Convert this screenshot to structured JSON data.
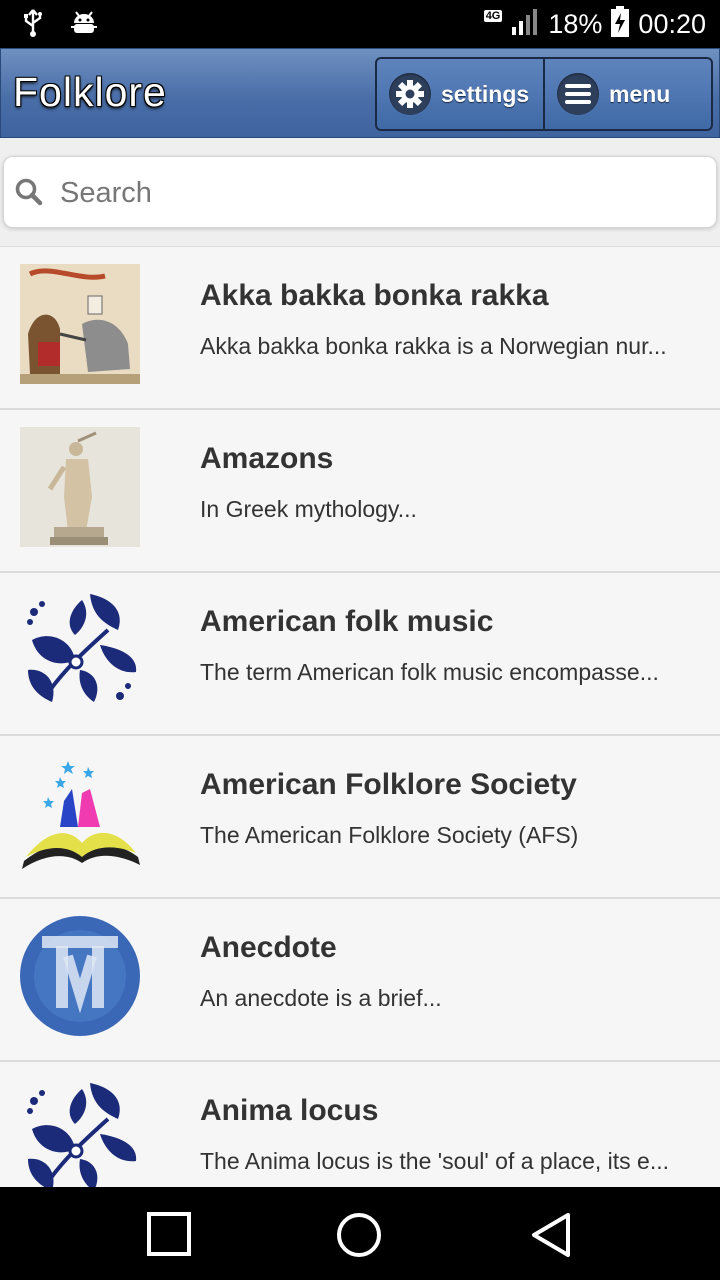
{
  "status_bar": {
    "network": "4G",
    "battery": "18%",
    "time": "00:20"
  },
  "header": {
    "title": "Folklore",
    "settings_label": "settings",
    "menu_label": "menu"
  },
  "search": {
    "placeholder": "Search",
    "value": ""
  },
  "items": [
    {
      "title": "Akka bakka bonka rakka",
      "desc": "Akka bakka bonka rakka is a Norwegian nur...",
      "thumb": "illustration-thumbnail"
    },
    {
      "title": "Amazons",
      "desc": "In Greek mythology...",
      "thumb": "statue-thumbnail"
    },
    {
      "title": "American folk music",
      "desc": "The term American folk music encompasse...",
      "thumb": "floral-ornament-thumbnail"
    },
    {
      "title": "American Folklore Society",
      "desc": "The American Folklore Society (AFS)",
      "thumb": "open-book-thumbnail"
    },
    {
      "title": "Anecdote",
      "desc": "An anecdote is a brief...",
      "thumb": "wikipedia-logo-thumbnail"
    },
    {
      "title": "Anima locus",
      "desc": "The Anima locus is the 'soul' of a place, its e...",
      "thumb": "floral-ornament-thumbnail"
    }
  ],
  "colors": {
    "header": "#4a6ea8",
    "list_bg": "#f6f6f6",
    "text": "#333333"
  }
}
